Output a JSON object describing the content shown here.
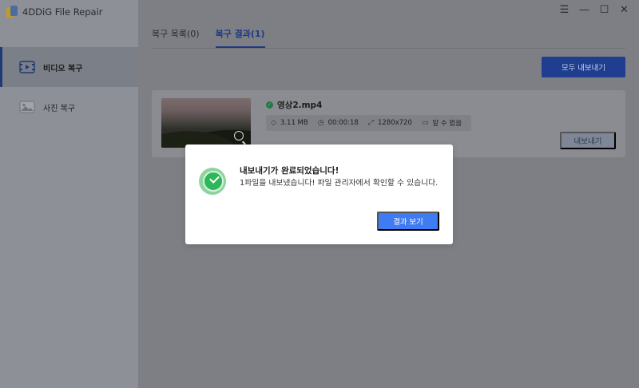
{
  "app": {
    "name": "4DDiG File Repair"
  },
  "sidebar": {
    "items": [
      {
        "label": "비디오 복구",
        "icon": "video-icon",
        "active": true
      },
      {
        "label": "사진 복구",
        "icon": "image-icon",
        "active": false
      }
    ]
  },
  "window_controls": [
    "menu-icon",
    "minimize-icon",
    "maximize-icon",
    "close-icon"
  ],
  "tabs": [
    {
      "label": "복구 목록(0)",
      "active": false
    },
    {
      "label": "복구 결과(1)",
      "active": true
    }
  ],
  "toolbar": {
    "export_all_label": "모두 내보내기"
  },
  "file": {
    "name": "영상2.mp4",
    "size": "3.11 MB",
    "duration": "00:00:18",
    "resolution": "1280x720",
    "codec": "알 수 없음",
    "export_label": "내보내기"
  },
  "dialog": {
    "title": "내보내기가 완료되었습니다!",
    "body": "1파일을 내보냈습니다! 파일 관리자에서 확인할 수 있습니다.",
    "button_label": "결과 보기"
  },
  "colors": {
    "accent": "#3f7bf2",
    "success": "#2eb65a"
  }
}
